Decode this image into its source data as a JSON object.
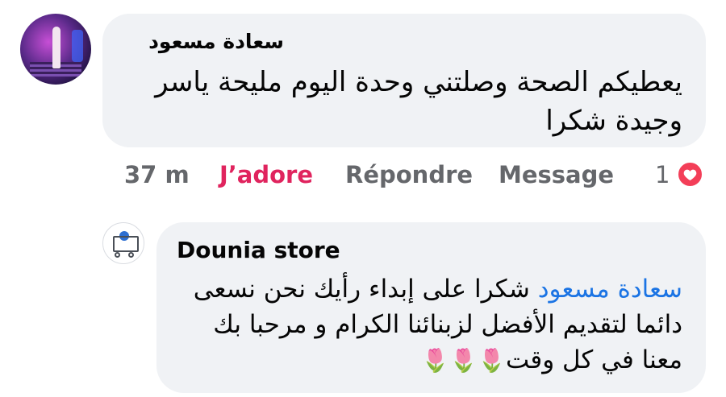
{
  "comment": {
    "author": "سعادة مسعود",
    "text": "يعطيكم الصحة وصلتني وحدة اليوم مليحة ياسر وجيدة شكرا",
    "time": "37 m",
    "like_label": "J’adore",
    "reply_label": "Répondre",
    "message_label": "Message",
    "reaction_count": "1",
    "reaction_icon": "heart-icon",
    "like_color": "#e0245e",
    "reaction_color": "#f33e58"
  },
  "reply": {
    "author": "Dounia store",
    "mention": "سعادة مسعود",
    "text": "شكرا على إبداء رأيك نحن نسعى دائما لتقديم الأفضل لزبنائنا الكرام و مرحبا بك معنا في كل وقت",
    "emoji": "🌷🌷🌷",
    "mention_color": "#1b74e4"
  }
}
